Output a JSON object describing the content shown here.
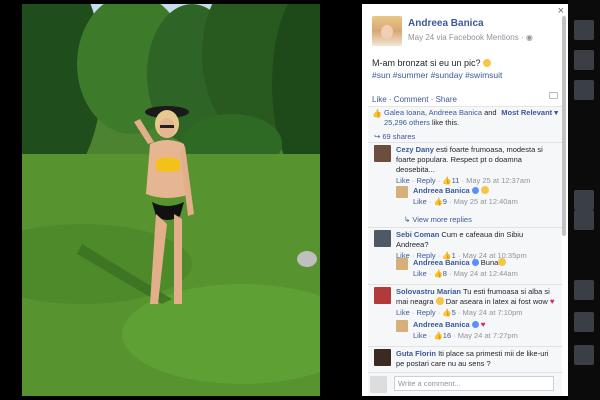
{
  "post": {
    "author": "Andreea Banica",
    "meta": "May 24 via Facebook Mentions · ",
    "text": "M-am bronzat si eu un pic?",
    "hashtags": "#sun #summer #sunday #swimsuit",
    "actions": [
      "Like",
      "Comment",
      "Share"
    ]
  },
  "likes": {
    "names": "Galea Ioana, Andreea Banica",
    "and_word": " and ",
    "others": "25,296 others",
    "suffix": " like this.",
    "sort_label": "Most Relevant ▾",
    "shares": "69 shares"
  },
  "comments": [
    {
      "name": "Cezy Dany",
      "text": " esti foarte frumoasa, modesta si foarte populara. Respect pt o doamna deosebita...",
      "like_label": "Like",
      "reply_label": "Reply",
      "likes": "11",
      "time": "May 25 at 12:37am"
    },
    {
      "name": "Sebi Coman",
      "text": " Cum e cafeaua din Sibiu Andreea?",
      "like_label": "Like",
      "reply_label": "Reply",
      "likes": "1",
      "time": "May 24 at 10:35pm"
    },
    {
      "name": "Solovastru Marian",
      "text": " Tu esti frumoasa si alba si mai neagra ",
      "text2": " Dar aseara in latex ai fost wow ",
      "like_label": "Like",
      "reply_label": "Reply",
      "likes": "5",
      "time": "May 24 at 7:10pm"
    },
    {
      "name": "Guta Florin",
      "text": " Iti place sa primesti mii de like-uri pe postari care nu au sens ?"
    }
  ],
  "replies": [
    {
      "name": "Andreea Banica",
      "text": "",
      "like_label": "Like",
      "likes": "9",
      "time": "May 25 at 12:40am"
    },
    {
      "name": "Andreea Banica",
      "text": "Buna",
      "like_label": "Like",
      "likes": "8",
      "time": "May 24 at 12:44am"
    },
    {
      "name": "Andreea Banica",
      "text": "",
      "like_label": "Like",
      "likes": "16",
      "time": "May 24 at 7:27pm"
    }
  ],
  "view_more_replies": "View more replies",
  "write_placeholder": "Write a comment...",
  "close_glyph": "×",
  "colors": {
    "link": "#3b5998",
    "meta": "#90949c",
    "grass": "#4a7f2f",
    "sky": "#c9dcee"
  }
}
